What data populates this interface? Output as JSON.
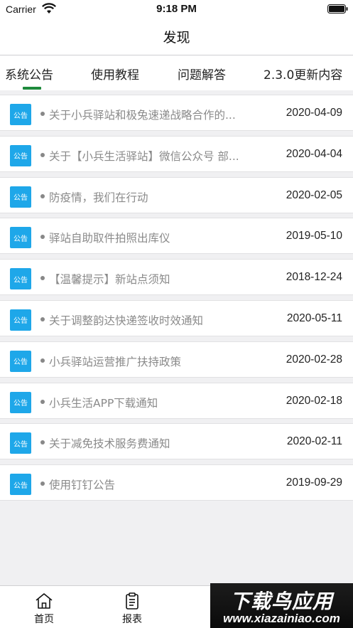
{
  "status_bar": {
    "carrier": "Carrier",
    "time": "9:18 PM"
  },
  "nav": {
    "title": "发现"
  },
  "tabs": [
    {
      "label": "系统公告"
    },
    {
      "label": "使用教程"
    },
    {
      "label": "问题解答"
    },
    {
      "label": "2.3.0更新内容"
    }
  ],
  "notices": [
    {
      "badge": "公告",
      "title": "关于小兵驿站和极兔速递战略合作的...",
      "date": "2020-04-09"
    },
    {
      "badge": "公告",
      "title": "关于【小兵生活驿站】微信公众号 部...",
      "date": "2020-04-04"
    },
    {
      "badge": "公告",
      "title": "防疫情，我们在行动",
      "date": "2020-02-05"
    },
    {
      "badge": "公告",
      "title": "驿站自助取件拍照出库仪",
      "date": "2019-05-10"
    },
    {
      "badge": "公告",
      "title": "【温馨提示】新站点须知",
      "date": "2018-12-24"
    },
    {
      "badge": "公告",
      "title": "关于调整韵达快递签收时效通知",
      "date": "2020-05-11"
    },
    {
      "badge": "公告",
      "title": "小兵驿站运营推广扶持政策",
      "date": "2020-02-28"
    },
    {
      "badge": "公告",
      "title": "小兵生活APP下载通知",
      "date": "2020-02-18"
    },
    {
      "badge": "公告",
      "title": "关于减免技术服务费通知",
      "date": "2020-02-11"
    },
    {
      "badge": "公告",
      "title": "使用钉钉公告",
      "date": "2019-09-29"
    }
  ],
  "tabbar": {
    "items": [
      {
        "label": "首页"
      },
      {
        "label": "报表"
      }
    ]
  },
  "watermark": {
    "text": "下载鸟应用",
    "url": "www.xiazainiao.com"
  },
  "colors": {
    "accent_green": "#1e8a3c",
    "badge_blue": "#1ea7e9"
  }
}
